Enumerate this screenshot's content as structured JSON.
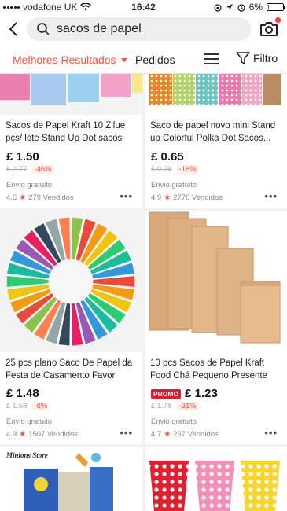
{
  "status_bar": {
    "carrier": "vodafone UK",
    "time": "16:42",
    "battery": "6%",
    "battery_level": 0.06
  },
  "search": {
    "query": "sacos de papel"
  },
  "filters": {
    "best_results": "Melhores Resultados",
    "orders": "Pedidos",
    "filter": "Filtro"
  },
  "products": [
    {
      "title": "Sacos de Papel Kraft 10 Zilue pçs/ lote Stand Up Dot sacos de...",
      "price": "£ 1.50",
      "old_price": "£ 2.77",
      "discount": "-46%",
      "shipping": "Envio gratuito",
      "rating": "4.6",
      "sold": "279 Vendidos",
      "promo": ""
    },
    {
      "title": "Saco de papel novo mini Stand up Colorful Polka Dot Sacos...",
      "price": "£ 0.65",
      "old_price": "£ 0.78",
      "discount": "-16%",
      "shipping": "Envio gratuito",
      "rating": "4.9",
      "sold": "2776 Vendidos",
      "promo": ""
    },
    {
      "title": "25 pcs plano Saco De Papel da Festa de Casamento Favor Doce...",
      "price": "£ 1.48",
      "old_price": "£ 1.58",
      "discount": "-6%",
      "shipping": "Envio gratuito",
      "rating": "4.9",
      "sold": "1507 Vendidos",
      "promo": ""
    },
    {
      "title": "10 pcs Sacos de Papel Kraft Food Chá Pequeno Presente Sacos de...",
      "price": "£ 1.23",
      "old_price": "£ 1.78",
      "discount": "-31%",
      "shipping": "Envio gratuito",
      "rating": "4.7",
      "sold": "267 Vendidos",
      "promo": "PROMO"
    }
  ],
  "image_text": {
    "watermark": "Minions Store"
  },
  "colors": {
    "accent": "#f5513b",
    "promo": "#e6182e"
  }
}
